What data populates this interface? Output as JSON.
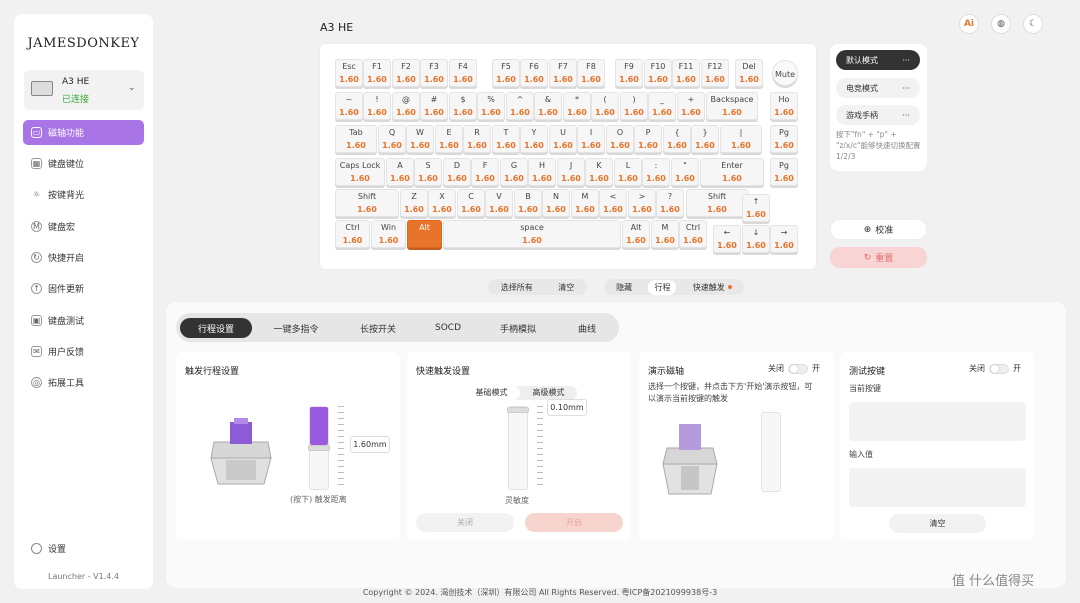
{
  "app": {
    "logo": "JAMESDONKEY",
    "version": "Launcher - V1.4.4",
    "settings": "设置"
  },
  "device": {
    "name": "A3 HE",
    "status": "已连接"
  },
  "nav": [
    {
      "label": "磁轴功能",
      "icon": "keyboard-icon"
    },
    {
      "label": "键盘键位",
      "icon": "keys-icon"
    },
    {
      "label": "按键背光",
      "icon": "light-icon"
    },
    {
      "label": "键盘宏",
      "icon": "macro-icon"
    },
    {
      "label": "快捷开启",
      "icon": "shortcut-icon"
    },
    {
      "label": "固件更新",
      "icon": "update-icon"
    },
    {
      "label": "键盘测试",
      "icon": "test-icon"
    },
    {
      "label": "用户反馈",
      "icon": "feedback-icon"
    },
    {
      "label": "拓展工具",
      "icon": "tools-icon"
    }
  ],
  "header": {
    "title": "A3 HE",
    "icons": [
      "ai-icon",
      "globe-icon",
      "theme-icon"
    ],
    "ai_label": "Ai"
  },
  "key_value": "1.60",
  "keyboard_rows": [
    [
      "Esc",
      "F1",
      "F2",
      "F3",
      "F4",
      "F5",
      "F6",
      "F7",
      "F8",
      "F9",
      "F10",
      "F11",
      "F12",
      "Del",
      "Mute"
    ],
    [
      "~",
      "!",
      "@",
      "#",
      "$",
      "%",
      "^",
      "&",
      "*",
      "(",
      ")",
      "_",
      "+",
      "Backspace",
      "Ho"
    ],
    [
      "Tab",
      "Q",
      "W",
      "E",
      "R",
      "T",
      "Y",
      "U",
      "I",
      "O",
      "P",
      "{",
      "}",
      "|",
      "Pg"
    ],
    [
      "Caps Lock",
      "A",
      "S",
      "D",
      "F",
      "G",
      "H",
      "J",
      "K",
      "L",
      ":",
      "\"",
      "Enter",
      "Pg"
    ],
    [
      "Shift",
      "Z",
      "X",
      "C",
      "V",
      "B",
      "N",
      "M",
      "<",
      ">",
      "?",
      "Shift",
      "↑"
    ],
    [
      "Ctrl",
      "Win",
      "Alt",
      "space",
      "Alt",
      "M",
      "Ctrl",
      "←",
      "↓",
      "→"
    ]
  ],
  "modes": {
    "items": [
      "默认模式",
      "电竞模式",
      "游戏手柄"
    ],
    "more": "···",
    "hint": "按下\"fn\" + \"p\" + \"z/x/c\"能够快速切换配置1/2/3"
  },
  "actions": {
    "calibrate": "校准",
    "reset": "重置"
  },
  "selection": {
    "select_all": "选择所有",
    "clear": "清空"
  },
  "view": {
    "hide": "隐藏",
    "travel": "行程",
    "rapid": "快速触发"
  },
  "tabs": [
    "行程设置",
    "一键多指令",
    "长按开关",
    "SOCD",
    "手柄模拟",
    "曲线"
  ],
  "card1": {
    "title": "触发行程设置",
    "value": "1.60mm",
    "caption": "(按下) 触发距离"
  },
  "card2": {
    "title": "快速触发设置",
    "modes": [
      "基础模式",
      "高级模式"
    ],
    "value": "0.10mm",
    "caption": "灵敏度",
    "off": "关闭",
    "on": "开启"
  },
  "card3": {
    "title": "演示磁轴",
    "off": "关闭",
    "on": "开",
    "desc": "选择一个按键，并点击下方'开始'演示按钮，可以演示当前按键的触发"
  },
  "card4": {
    "title": "测试按键",
    "off": "关闭",
    "on": "开",
    "current": "当前按键",
    "input": "输入值",
    "clear": "清空"
  },
  "footer": "Copyright © 2024. 渴创技术（深圳）有限公司 All Rights Reserved. 粤ICP备2021099938号-3",
  "watermark": "值 什么值得买",
  "colors": {
    "accent": "#a974e6",
    "orange": "#e8742b",
    "reset_bg": "#f8d4d4"
  }
}
